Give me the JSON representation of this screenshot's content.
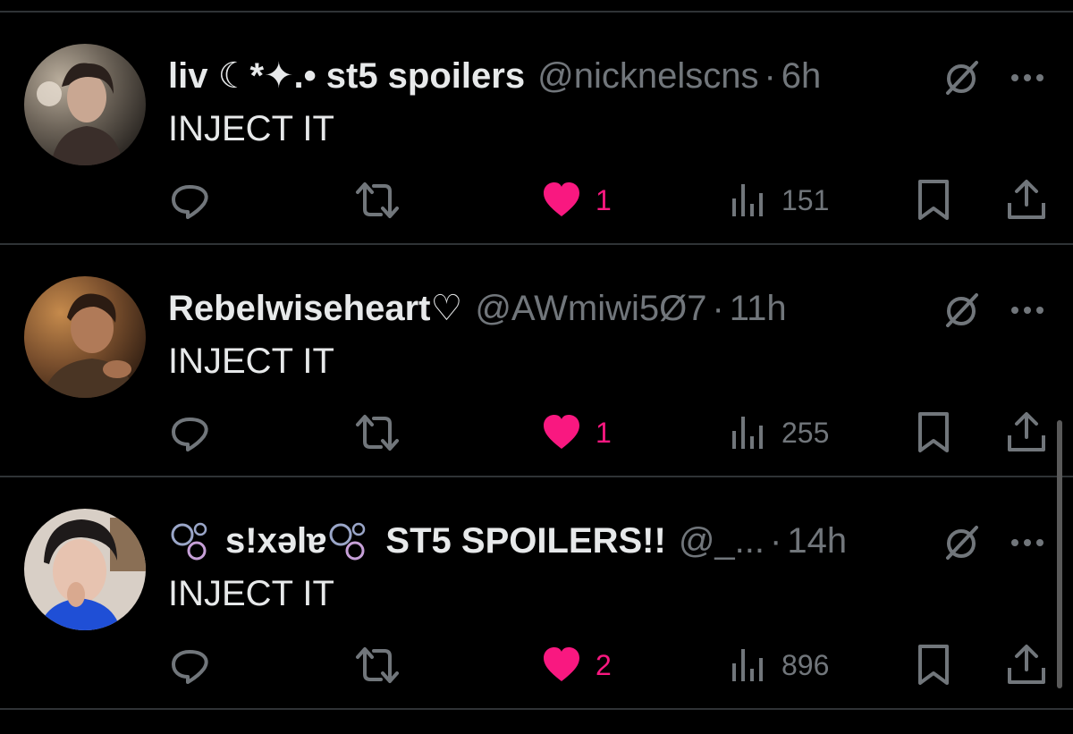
{
  "theme": {
    "background": "#000000",
    "text": "#e7e9ea",
    "muted": "#71767b",
    "divider": "#2f3336",
    "like_active": "#f91880"
  },
  "tweets": [
    {
      "display_name": "liv ☾*✦.• st5 spoilers",
      "handle": "@nicknelscns",
      "separator": "·",
      "time": "6h",
      "text": "INJECT IT",
      "likes": "1",
      "views": "151",
      "liked": true
    },
    {
      "display_name": "Rebelwiseheart♡",
      "handle": "@AWmiwi5Ø7",
      "separator": "·",
      "time": "11h",
      "text": "INJECT IT",
      "likes": "1",
      "views": "255",
      "liked": true
    },
    {
      "display_name_part1": "s!xəlɐ",
      "display_name_part2": "ST5 SPOILERS!!",
      "handle": "@_...",
      "separator": "·",
      "time": "14h",
      "text": "INJECT IT",
      "likes": "2",
      "views": "896",
      "liked": true
    }
  ],
  "icons": {
    "reply": "speech-bubble-icon",
    "retweet": "retweet-arrows-icon",
    "like": "heart-icon",
    "views": "bar-chart-icon",
    "bookmark": "bookmark-icon",
    "share": "share-upload-icon",
    "grok": "grok-slash-circle-icon",
    "more": "three-dots-icon"
  }
}
